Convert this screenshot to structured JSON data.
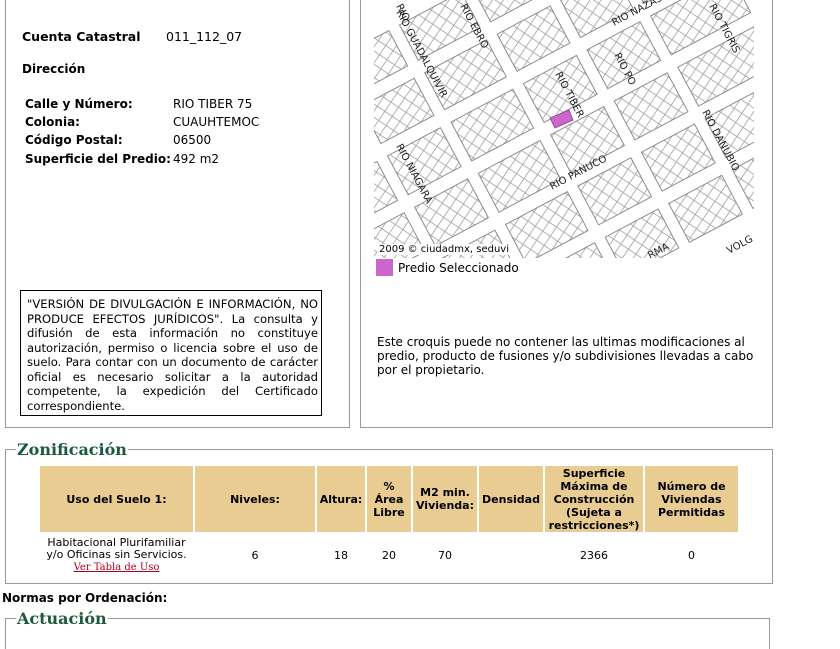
{
  "predio": {
    "cuenta_label": "Cuenta Catastral",
    "cuenta_value": "011_112_07",
    "direccion_label": "Dirección",
    "calle_label": "Calle y Número:",
    "calle_value": "RIO TIBER 75",
    "colonia_label": "Colonia:",
    "colonia_value": "CUAUHTEMOC",
    "cp_label": "Código Postal:",
    "cp_value": "06500",
    "superficie_label": "Superficie del Predio:",
    "superficie_value": "492 m2"
  },
  "notice": {
    "text": "\"VERSIÓN DE DIVULGACIÓN E INFORMACIÓN, NO PRODUCE EFECTOS JURÍDICOS\". La consulta y difusión de esta información no constituye autorización, permiso o licencia sobre el uso de suelo. Para contar con un documento de carácter oficial es necesario solicitar a la autoridad competente, la expedición del Certificado correspondiente."
  },
  "map": {
    "streets": {
      "guadalquivir": "RIO GUADALQUIVIR",
      "ebro": "RIO EBRO",
      "rio_partial": "RIO",
      "nazas": "RIO NAZAS",
      "tigris": "RIO TIGRIS",
      "po": "RIO PO",
      "tiber": "RIO TIBER",
      "danubio": "RIO DANUBIO",
      "niagara": "RIO NIAGARA",
      "panuco": "RIO PANUCO",
      "rma": "RMA",
      "volg": "VOLG"
    },
    "copyright": "2009 © ciudadmx, seduvi",
    "legend_label": "Predio Seleccionado",
    "highlight_color": "#cc66cc"
  },
  "croquis_note": "Este croquis puede no contener las ultimas modificaciones al predio, producto de fusiones y/o subdivisiones llevadas a cabo por el propietario.",
  "zonificacion": {
    "title": "Zonificación",
    "headers": {
      "uso": "Uso del Suelo 1:",
      "niveles": "Niveles:",
      "altura": "Altura:",
      "area_pct": "%",
      "area_label": "Área",
      "area_libre": "Libre",
      "m2_1": "M2 min.",
      "m2_2": "Vivienda:",
      "densidad": "Densidad",
      "sup_1": "Superficie",
      "sup_2": "Máxima de",
      "sup_3": "Construcción",
      "sup_4": "(Sujeta a",
      "sup_5": "restricciones*)",
      "num_1": "Número de",
      "num_2": "Viviendas",
      "num_3": "Permitidas"
    },
    "row": {
      "uso_1": "Habitacional Plurifamiliar",
      "uso_2": "y/o Oficinas sin Servicios.",
      "ver_tabla": "Ver Tabla de Uso",
      "niveles": "6",
      "altura": "18",
      "area_libre": "20",
      "m2_vivienda": "70",
      "densidad": "",
      "superficie": "2366",
      "num_viviendas": "0"
    }
  },
  "normas": {
    "title": "Normas por Ordenación:",
    "actuacion": "Actuación"
  }
}
